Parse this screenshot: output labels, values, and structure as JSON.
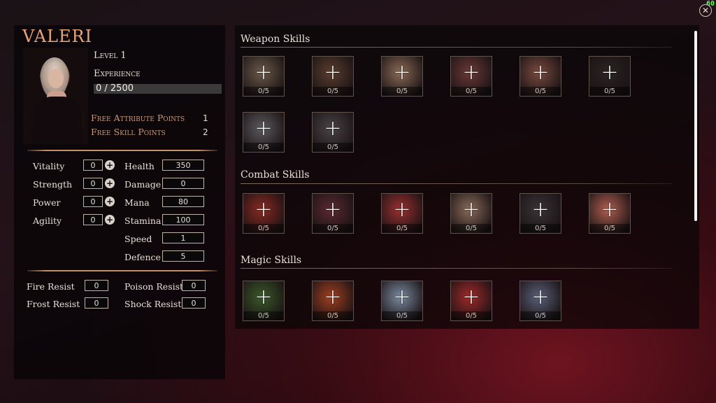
{
  "fps": "60",
  "close_icon": "close-circle-icon",
  "character": {
    "name": "VALERI",
    "level_label": "Level 1",
    "experience_label": "Experience",
    "experience_value": "0 / 2500",
    "experience_progress": 0,
    "free_attribute_label": "Free Attribute Points",
    "free_attribute_value": "1",
    "free_skill_label": "Free Skill Points",
    "free_skill_value": "2"
  },
  "attributes": [
    {
      "label": "Vitality",
      "value": "0"
    },
    {
      "label": "Strength",
      "value": "0"
    },
    {
      "label": "Power",
      "value": "0"
    },
    {
      "label": "Agility",
      "value": "0"
    }
  ],
  "derived_stats": [
    {
      "label": "Health",
      "value": "350"
    },
    {
      "label": "Damage",
      "value": "0"
    },
    {
      "label": "Mana",
      "value": "80"
    },
    {
      "label": "Stamina",
      "value": "100"
    },
    {
      "label": "Speed",
      "value": "1"
    },
    {
      "label": "Defence",
      "value": "5"
    }
  ],
  "resists": [
    {
      "label": "Fire Resist",
      "value": "0"
    },
    {
      "label": "Poison Resist",
      "value": "0"
    },
    {
      "label": "Frost Resist",
      "value": "0"
    },
    {
      "label": "Shock Resist",
      "value": "0"
    }
  ],
  "skill_sections": [
    {
      "title": "Weapon Skills",
      "skills": [
        {
          "count": "0/5",
          "color": "#6b5a4a"
        },
        {
          "count": "0/5",
          "color": "#5a3d2e"
        },
        {
          "count": "0/5",
          "color": "#8a6a56"
        },
        {
          "count": "0/5",
          "color": "#6a3a36"
        },
        {
          "count": "0/5",
          "color": "#7a4a40"
        },
        {
          "count": "0/5",
          "color": "#2a2422"
        },
        {
          "count": "0/5",
          "color": "#5c5a5e"
        },
        {
          "count": "0/5",
          "color": "#4a4446"
        }
      ]
    },
    {
      "title": "Combat Skills",
      "skills": [
        {
          "count": "0/5",
          "color": "#8a2a22"
        },
        {
          "count": "0/5",
          "color": "#5a2a30"
        },
        {
          "count": "0/5",
          "color": "#9a3030"
        },
        {
          "count": "0/5",
          "color": "#8a6a5a"
        },
        {
          "count": "0/5",
          "color": "#3a3436"
        },
        {
          "count": "0/5",
          "color": "#b06050"
        }
      ]
    },
    {
      "title": "Magic Skills",
      "skills": [
        {
          "count": "0/5",
          "color": "#3a5a2a"
        },
        {
          "count": "0/5",
          "color": "#a04020"
        },
        {
          "count": "0/5",
          "color": "#7a8aa0"
        },
        {
          "count": "0/5",
          "color": "#a02a2a"
        },
        {
          "count": "0/5",
          "color": "#5a6078"
        }
      ]
    }
  ]
}
